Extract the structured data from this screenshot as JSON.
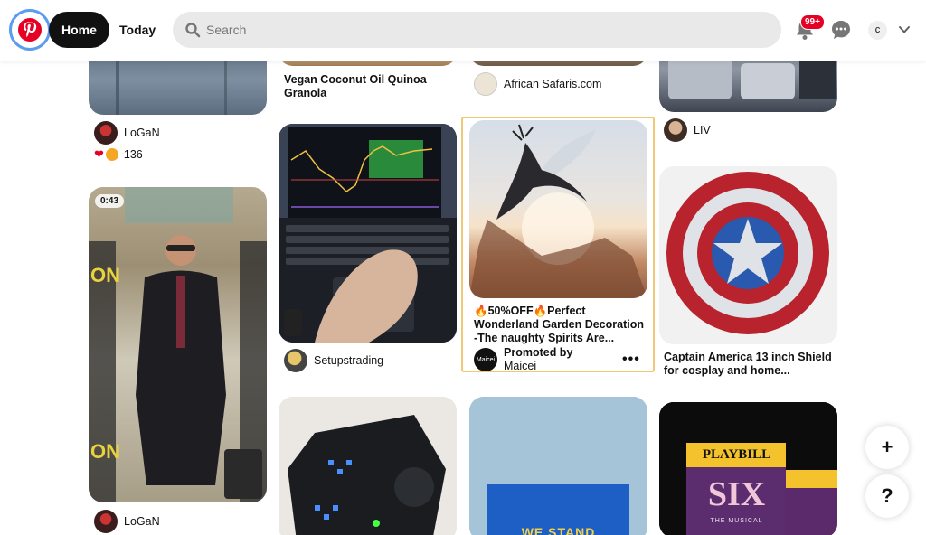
{
  "header": {
    "nav_home": "Home",
    "nav_today": "Today",
    "search_placeholder": "Search",
    "notifications_badge": "99+",
    "avatar_initial": "c",
    "brand_color": "#e60023"
  },
  "pins": {
    "col1": {
      "top_user": "LoGaN",
      "reaction_count": "136",
      "video_duration": "0:43",
      "bottom_user": "LoGaN"
    },
    "col2": {
      "top_title_line1": "Vegan Coconut Oil Quinoa",
      "top_title_line2": "Granola",
      "trading_user": "Setupstrading"
    },
    "col3": {
      "top_user": "African Safaris.com",
      "promo_title_line1": "🔥50%OFF🔥Perfect",
      "promo_title_line2": "Wonderland Garden Decoration",
      "promo_title_line3": "-The naughty Spirits Are...",
      "promoted_by": "Promoted by",
      "advertiser": "Maicei",
      "advertiser_logo_text": "Maicei",
      "more_label": "•••",
      "bottom_banner_text": "WE STAND"
    },
    "col4": {
      "top_user": "LIV",
      "shield_title_line1": "Captain America 13 inch Shield",
      "shield_title_line2": "for cosplay and home...",
      "playbill_brand": "PLAYBILL",
      "playbill_show": "SIX",
      "playbill_sub": "THE MUSICAL"
    }
  },
  "fab": {
    "add_label": "+",
    "help_label": "?"
  },
  "icons": [
    "pinterest-logo-icon",
    "search-icon",
    "bell-icon",
    "message-icon",
    "chevron-down-icon",
    "heart-reaction-icon",
    "wow-reaction-icon"
  ]
}
